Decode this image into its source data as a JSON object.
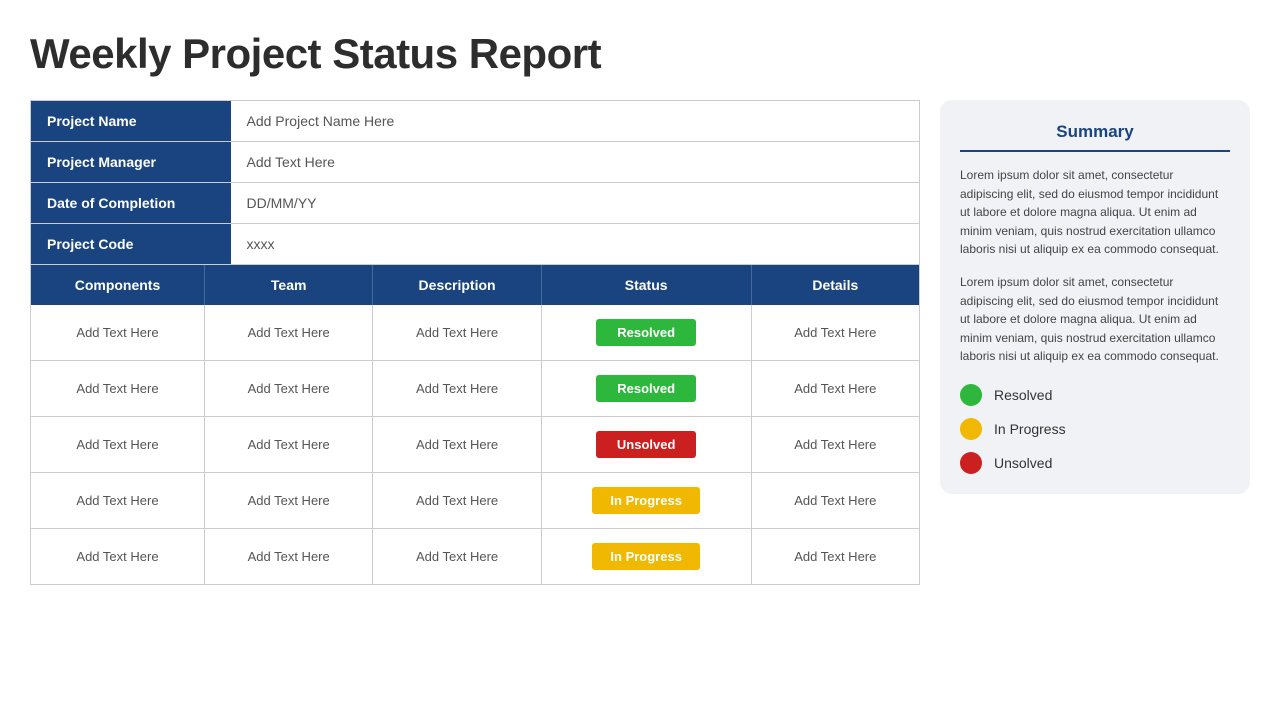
{
  "page": {
    "title": "Weekly Project Status Report"
  },
  "info_table": {
    "rows": [
      {
        "label": "Project Name",
        "value": "Add Project Name Here"
      },
      {
        "label": "Project Manager",
        "value": "Add Text Here"
      },
      {
        "label": "Date of Completion",
        "value": "DD/MM/YY"
      },
      {
        "label": "Project Code",
        "value": "xxxx"
      }
    ]
  },
  "components_table": {
    "headers": [
      "Components",
      "Team",
      "Description",
      "Status",
      "Details"
    ],
    "rows": [
      {
        "component": "Add Text Here",
        "team": "Add Text Here",
        "description": "Add Text Here",
        "status": "Resolved",
        "status_type": "resolved",
        "details": "Add Text Here"
      },
      {
        "component": "Add Text Here",
        "team": "Add Text Here",
        "description": "Add Text Here",
        "status": "Resolved",
        "status_type": "resolved",
        "details": "Add Text Here"
      },
      {
        "component": "Add Text Here",
        "team": "Add Text Here",
        "description": "Add Text Here",
        "status": "Unsolved",
        "status_type": "unsolved",
        "details": "Add Text Here"
      },
      {
        "component": "Add Text Here",
        "team": "Add Text Here",
        "description": "Add Text Here",
        "status": "In Progress",
        "status_type": "inprogress",
        "details": "Add Text Here"
      },
      {
        "component": "Add Text Here",
        "team": "Add Text Here",
        "description": "Add Text Here",
        "status": "In Progress",
        "status_type": "inprogress",
        "details": "Add Text Here"
      }
    ]
  },
  "summary": {
    "title": "Summary",
    "paragraph1": "Lorem ipsum dolor sit amet, consectetur adipiscing elit, sed do eiusmod tempor incididunt ut labore et dolore magna aliqua. Ut enim ad minim veniam, quis nostrud exercitation ullamco laboris nisi ut aliquip ex ea commodo  consequat.",
    "paragraph2": "Lorem ipsum dolor sit amet, consectetur adipiscing elit, sed do eiusmod tempor incididunt ut labore et dolore magna aliqua. Ut enim ad minim veniam, quis nostrud exercitation ullamco laboris nisi ut aliquip ex ea commodo  consequat.",
    "legend": [
      {
        "label": "Resolved",
        "color": "#2db83d"
      },
      {
        "label": "In Progress",
        "color": "#f0b800"
      },
      {
        "label": "Unsolved",
        "color": "#cc1f1f"
      }
    ]
  }
}
